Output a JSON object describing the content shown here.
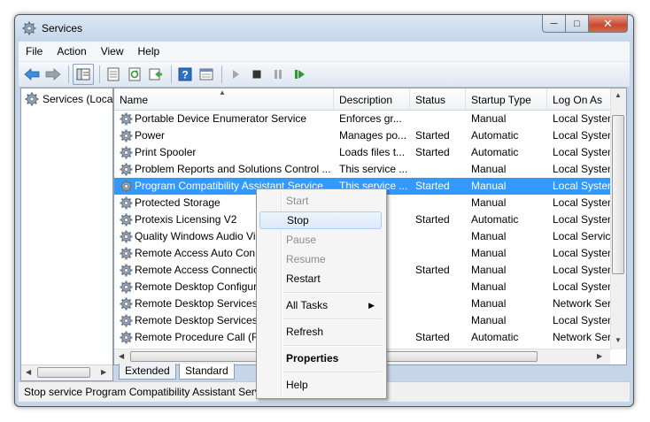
{
  "window": {
    "title": "Services"
  },
  "menubar": {
    "items": [
      "File",
      "Action",
      "View",
      "Help"
    ]
  },
  "tree": {
    "root_label": "Services (Loca"
  },
  "table": {
    "columns": [
      "Name",
      "Description",
      "Status",
      "Startup Type",
      "Log On As"
    ],
    "rows": [
      {
        "name": "Portable Device Enumerator Service",
        "description": "Enforces gr...",
        "status": "",
        "startup": "Manual",
        "logon": "Local System"
      },
      {
        "name": "Power",
        "description": "Manages po...",
        "status": "Started",
        "startup": "Automatic",
        "logon": "Local System"
      },
      {
        "name": "Print Spooler",
        "description": "Loads files t...",
        "status": "Started",
        "startup": "Automatic",
        "logon": "Local System"
      },
      {
        "name": "Problem Reports and Solutions Control ...",
        "description": "This service ...",
        "status": "",
        "startup": "Manual",
        "logon": "Local System"
      },
      {
        "name": "Program Compatibility Assistant Service",
        "description": "This service ...",
        "status": "Started",
        "startup": "Manual",
        "logon": "Local System"
      },
      {
        "name": "Protected Storage",
        "description": "",
        "status": "",
        "startup": "Manual",
        "logon": "Local System"
      },
      {
        "name": "Protexis Licensing V2",
        "description": "",
        "status": "Started",
        "startup": "Automatic",
        "logon": "Local System"
      },
      {
        "name": "Quality Windows Audio Vi",
        "description": "",
        "status": "",
        "startup": "Manual",
        "logon": "Local Service"
      },
      {
        "name": "Remote Access Auto Conn",
        "description": "",
        "status": "",
        "startup": "Manual",
        "logon": "Local System"
      },
      {
        "name": "Remote Access Connectio",
        "description": "di...",
        "status": "Started",
        "startup": "Manual",
        "logon": "Local System"
      },
      {
        "name": "Remote Desktop Configur",
        "description": "ses...",
        "status": "",
        "startup": "Manual",
        "logon": "Local System"
      },
      {
        "name": "Remote Desktop Services",
        "description": "ers...",
        "status": "",
        "startup": "Manual",
        "logon": "Network Ser"
      },
      {
        "name": "Remote Desktop Services U",
        "description": "",
        "status": "",
        "startup": "Manual",
        "logon": "Local System"
      },
      {
        "name": "Remote Procedure Call (RI",
        "description": "s s...",
        "status": "Started",
        "startup": "Automatic",
        "logon": "Network Ser"
      }
    ],
    "selected_index": 4
  },
  "tabs": [
    "Extended",
    "Standard"
  ],
  "status": {
    "text": "Stop service Program Compatibility Assistant Servi"
  },
  "context_menu": {
    "start": "Start",
    "stop": "Stop",
    "pause": "Pause",
    "resume": "Resume",
    "restart": "Restart",
    "all_tasks": "All Tasks",
    "refresh": "Refresh",
    "properties": "Properties",
    "help": "Help"
  },
  "colors": {
    "selection": "#3399ff",
    "frame": "#c5d6ea"
  },
  "icons": [
    "app-gear-icon",
    "back-icon",
    "forward-icon",
    "show-tree-icon",
    "export-list-icon",
    "refresh-icon",
    "export-icon",
    "help-icon",
    "properties-icon",
    "play-icon",
    "stop-icon",
    "pause-icon",
    "restart-icon",
    "service-gear-icon"
  ]
}
